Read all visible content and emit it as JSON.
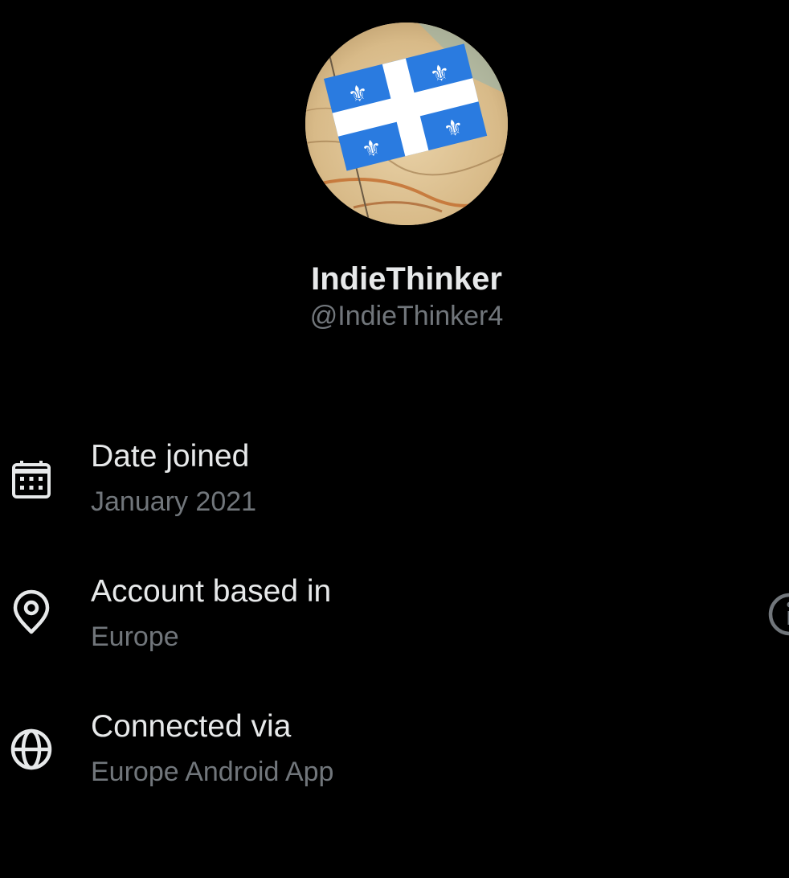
{
  "profile": {
    "display_name": "IndieThinker",
    "handle": "@IndieThinker4",
    "avatar": "quebec-flag-on-map-avatar"
  },
  "details": [
    {
      "icon": "calendar-icon",
      "label": "Date joined",
      "value": "January 2021"
    },
    {
      "icon": "location-pin-icon",
      "label": "Account based in",
      "value": "Europe",
      "trailing_icon": "info-icon"
    },
    {
      "icon": "globe-icon",
      "label": "Connected via",
      "value": "Europe Android App"
    }
  ],
  "colors": {
    "background": "#000000",
    "primary_text": "#e7e9ea",
    "secondary_text": "#71767b",
    "flag_blue": "#1f6fd1",
    "flag_white": "#ffffff"
  }
}
